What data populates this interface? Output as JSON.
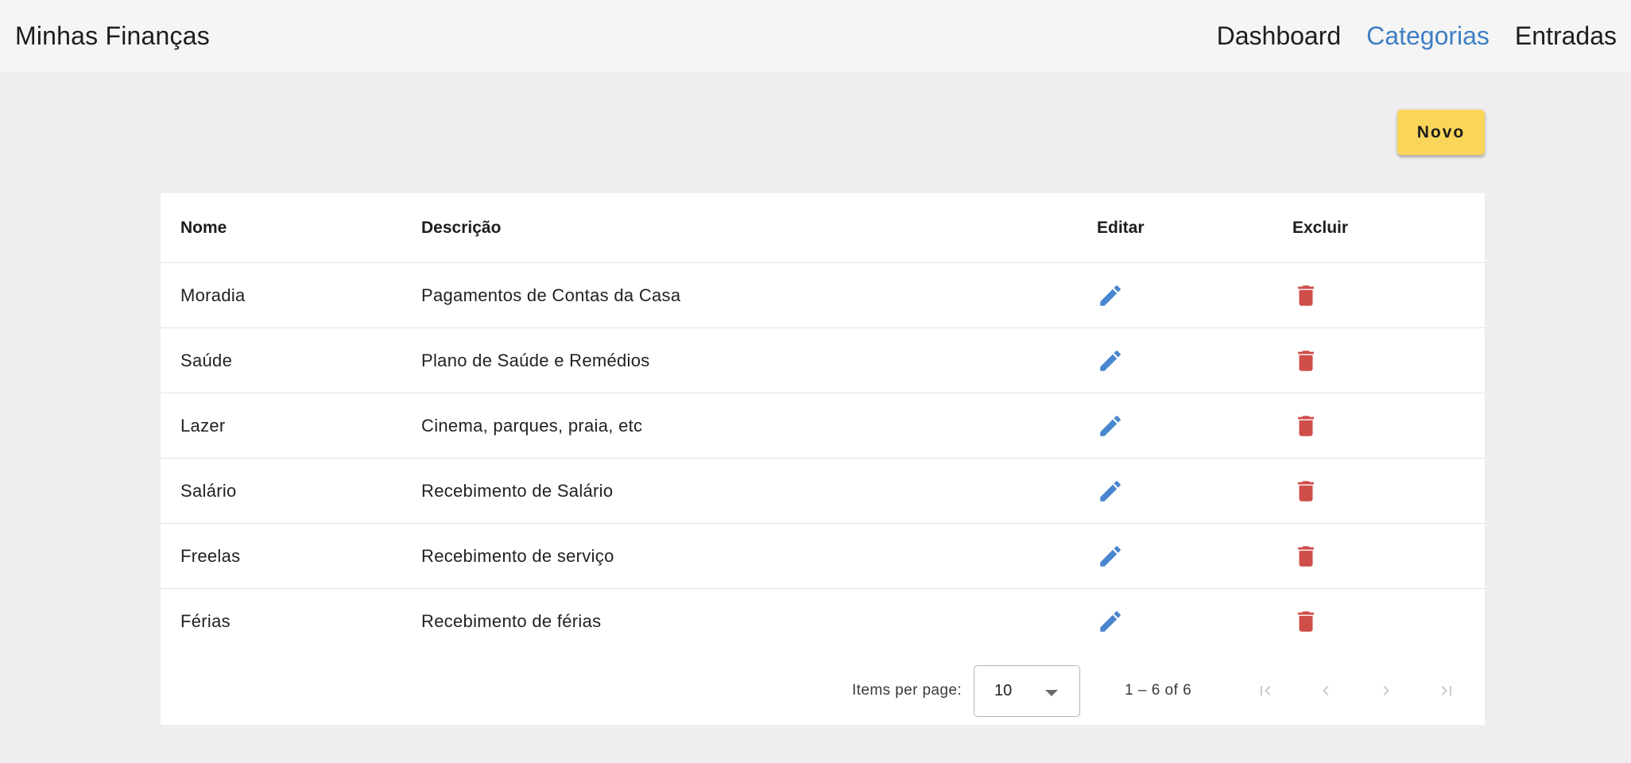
{
  "header": {
    "title": "Minhas Finanças",
    "nav": [
      {
        "label": "Dashboard",
        "active": false
      },
      {
        "label": "Categorias",
        "active": true
      },
      {
        "label": "Entradas",
        "active": false
      }
    ]
  },
  "actions": {
    "new_label": "Novo"
  },
  "table": {
    "columns": {
      "nome": "Nome",
      "descricao": "Descrição",
      "editar": "Editar",
      "excluir": "Excluir"
    },
    "rows": [
      {
        "nome": "Moradia",
        "descricao": "Pagamentos de Contas da Casa"
      },
      {
        "nome": "Saúde",
        "descricao": "Plano de Saúde e Remédios"
      },
      {
        "nome": "Lazer",
        "descricao": "Cinema, parques, praia, etc"
      },
      {
        "nome": "Salário",
        "descricao": "Recebimento de Salário"
      },
      {
        "nome": "Freelas",
        "descricao": "Recebimento de serviço"
      },
      {
        "nome": "Férias",
        "descricao": "Recebimento de férias"
      }
    ]
  },
  "paginator": {
    "items_per_page_label": "Items per page:",
    "page_size": "10",
    "range_label": "1 – 6 of 6"
  },
  "colors": {
    "accent": "#3f7fc4",
    "edit_icon": "#4a86cf",
    "delete_icon": "#cf4e4a",
    "new_button": "#f9d55a"
  },
  "icons": {
    "edit": "pencil-icon",
    "delete": "trash-icon"
  }
}
